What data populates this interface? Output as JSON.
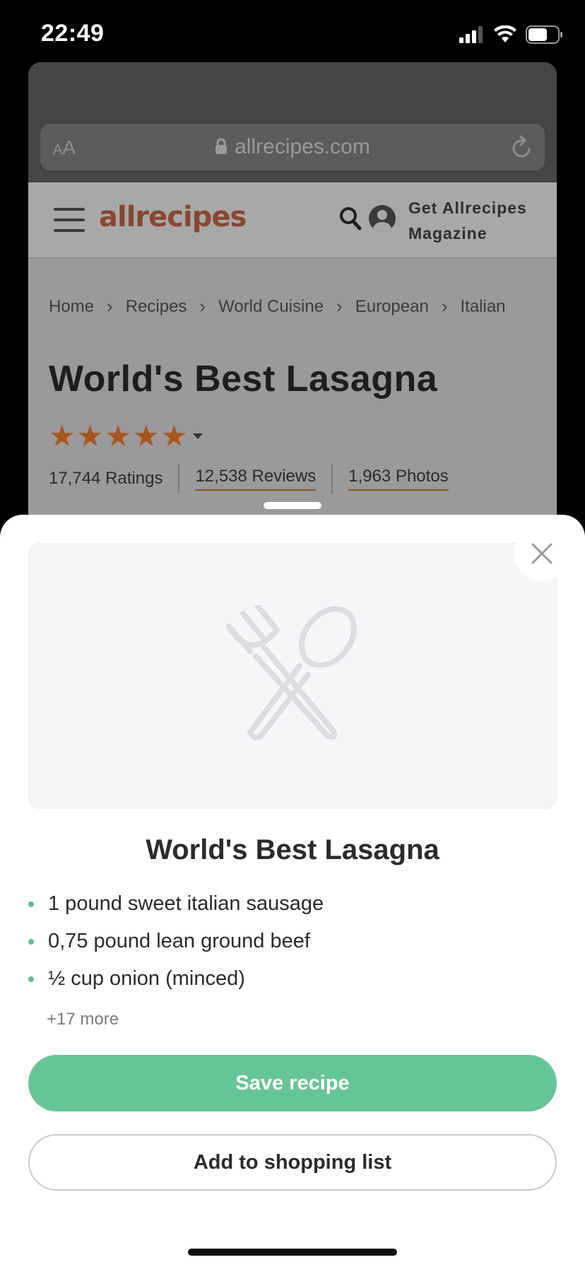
{
  "status_bar": {
    "time": "22:49"
  },
  "browser": {
    "aa_label": "AA",
    "url": "allrecipes.com"
  },
  "site": {
    "logo_text": "allrecipes",
    "magazine_cta_line1": "Get Allrecipes",
    "magazine_cta_line2": "Magazine",
    "breadcrumb": [
      "Home",
      "Recipes",
      "World Cuisine",
      "European",
      "Italian"
    ],
    "recipe_title": "World's Best Lasagna",
    "rating_stars": 5,
    "ratings_count": "17,744 Ratings",
    "reviews_count": "12,538 Reviews",
    "photos_count": "1,963 Photos"
  },
  "sheet": {
    "title": "World's Best Lasagna",
    "ingredients": [
      "1 pound sweet italian sausage",
      "0,75 pound lean ground beef",
      " ½ cup onion (minced)"
    ],
    "more": "+17 more",
    "save_label": "Save recipe",
    "shopping_label": "Add to shopping list"
  },
  "colors": {
    "accent_green": "#66c596",
    "bullet_green": "#5fbf8f",
    "star_color": "#a8561c"
  }
}
